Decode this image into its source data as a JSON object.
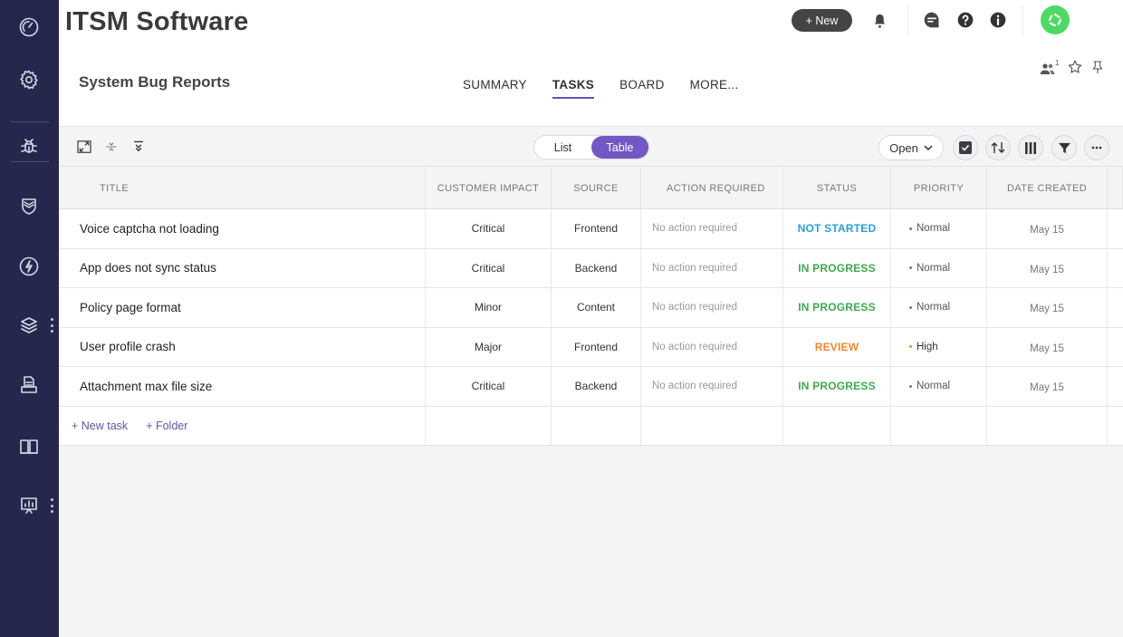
{
  "app": {
    "title": "ITSM Software"
  },
  "project": {
    "title": "System Bug Reports"
  },
  "sidebar": {
    "items": [
      {
        "name": "dashboard",
        "icon": "gauge-icon"
      },
      {
        "name": "settings",
        "icon": "gear-icon"
      },
      {
        "name": "bug-reports",
        "icon": "bug-icon",
        "active": true
      },
      {
        "name": "security",
        "icon": "shield-icon"
      },
      {
        "name": "incidents",
        "icon": "lightning-icon"
      },
      {
        "name": "layers",
        "icon": "layers-icon"
      },
      {
        "name": "documents",
        "icon": "inbox-document-icon"
      },
      {
        "name": "knowledge-base",
        "icon": "book-icon"
      },
      {
        "name": "reports",
        "icon": "presentation-chart-icon"
      }
    ]
  },
  "header": {
    "new_label": "+ New",
    "avatar_color": "#4cd964",
    "members_count": "1"
  },
  "tabs": [
    {
      "label": "SUMMARY",
      "active": false
    },
    {
      "label": "TASKS",
      "active": true
    },
    {
      "label": "BOARD",
      "active": false
    },
    {
      "label": "MORE...",
      "active": false
    }
  ],
  "toolbar": {
    "view_toggle": {
      "options": [
        "List",
        "Table"
      ],
      "selected": "Table"
    },
    "filter_dropdown": {
      "selected": "Open"
    }
  },
  "table": {
    "columns": [
      "TITLE",
      "CUSTOMER IMPACT",
      "SOURCE",
      "ACTION REQUIRED",
      "STATUS",
      "PRIORITY",
      "DATE CREATED"
    ],
    "rows": [
      {
        "title": "Voice captcha not loading",
        "impact": "Critical",
        "source": "Frontend",
        "action": "No action required",
        "status": "NOT STARTED",
        "status_color": "#2a9fd8",
        "priority": "Normal",
        "priority_color": "#777777",
        "date": "May 15"
      },
      {
        "title": "App does not sync status",
        "impact": "Critical",
        "source": "Backend",
        "action": "No action required",
        "status": "IN PROGRESS",
        "status_color": "#3eaa4e",
        "priority": "Normal",
        "priority_color": "#777777",
        "date": "May 15"
      },
      {
        "title": "Policy page format",
        "impact": "Minor",
        "source": "Content",
        "action": "No action required",
        "status": "IN PROGRESS",
        "status_color": "#3eaa4e",
        "priority": "Normal",
        "priority_color": "#777777",
        "date": "May 15"
      },
      {
        "title": "User profile crash",
        "impact": "Major",
        "source": "Frontend",
        "action": "No action required",
        "status": "REVIEW",
        "status_color": "#ee8a2d",
        "priority": "High",
        "priority_color": "#ee8a2d",
        "date": "May 15"
      },
      {
        "title": "Attachment max file size",
        "impact": "Critical",
        "source": "Backend",
        "action": "No action required",
        "status": "IN PROGRESS",
        "status_color": "#3eaa4e",
        "priority": "Normal",
        "priority_color": "#777777",
        "date": "May 15"
      }
    ],
    "add_task_label": "+ New task",
    "add_folder_label": "+ Folder"
  }
}
